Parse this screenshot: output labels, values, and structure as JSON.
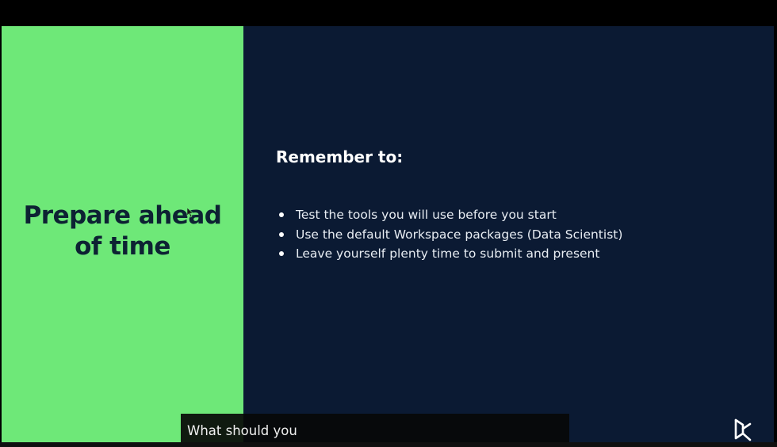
{
  "slide": {
    "headline_line1": "Prepare ahead",
    "headline_line2": "of time",
    "subheading": "Remember to:",
    "bullets": [
      "Test the tools you will use before you start",
      "Use the default Workspace packages (Data Scientist)",
      "Leave yourself plenty time to submit and present"
    ]
  },
  "caption": {
    "text": "What should you"
  },
  "colors": {
    "left_panel": "#6ee878",
    "right_panel": "#0b1a33",
    "headline_text": "#0d2233",
    "body_text": "#ffffff"
  },
  "icons": {
    "cursor": "mouse-pointer-icon",
    "logo": "datacamp-logo-icon"
  }
}
